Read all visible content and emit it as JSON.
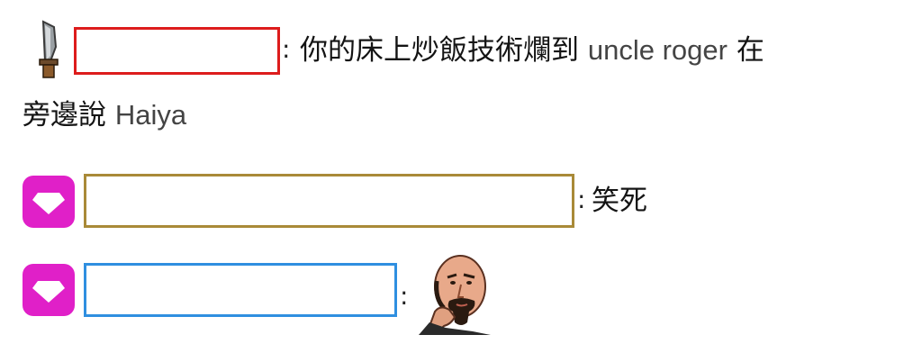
{
  "messages": [
    {
      "badge_icon": "knife-icon",
      "name_box_color": "#dd1c1c",
      "separator": ":",
      "text_cjk_1": "你的床上炒飯技術爛到",
      "text_latin_1": "uncle roger",
      "text_cjk_2": "在",
      "text_cjk_3": "旁邊說",
      "text_latin_2": "Haiya"
    },
    {
      "badge_icon": "diamond-icon",
      "badge_color": "#e020c8",
      "name_box_color": "#a98a38",
      "separator": ":",
      "text": "笑死"
    },
    {
      "badge_icon": "diamond-icon",
      "badge_color": "#e020c8",
      "name_box_color": "#2f8fe0",
      "separator": ":",
      "emote_icon": "bald-man-thinking-emote"
    }
  ]
}
